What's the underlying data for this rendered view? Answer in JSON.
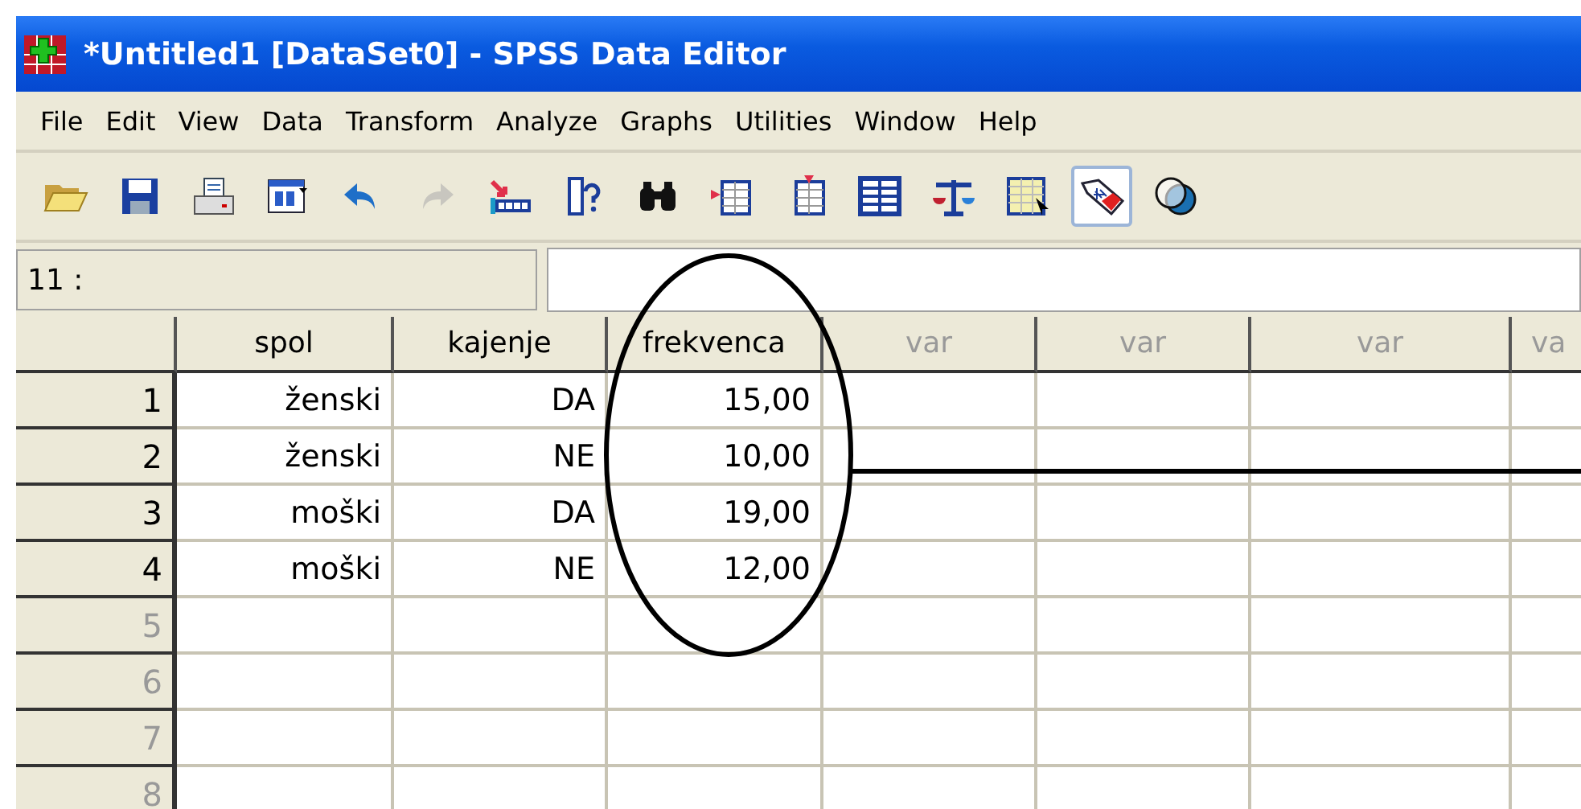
{
  "window": {
    "title": "*Untitled1 [DataSet0] - SPSS Data Editor"
  },
  "menu": [
    "File",
    "Edit",
    "View",
    "Data",
    "Transform",
    "Analyze",
    "Graphs",
    "Utilities",
    "Window",
    "Help"
  ],
  "toolbar": [
    {
      "kind": "open",
      "pressed": false,
      "disabled": false
    },
    {
      "kind": "save",
      "pressed": false,
      "disabled": false
    },
    {
      "kind": "print",
      "pressed": false,
      "disabled": false
    },
    {
      "kind": "dialog",
      "pressed": false,
      "disabled": false
    },
    {
      "kind": "undo",
      "pressed": false,
      "disabled": false
    },
    {
      "kind": "redo",
      "pressed": false,
      "disabled": true
    },
    {
      "kind": "goto",
      "pressed": false,
      "disabled": false
    },
    {
      "kind": "variables",
      "pressed": false,
      "disabled": false
    },
    {
      "kind": "find",
      "pressed": false,
      "disabled": false
    },
    {
      "kind": "insert-case",
      "pressed": false,
      "disabled": false
    },
    {
      "kind": "insert-variable",
      "pressed": false,
      "disabled": false
    },
    {
      "kind": "split",
      "pressed": false,
      "disabled": false
    },
    {
      "kind": "weight",
      "pressed": false,
      "disabled": false
    },
    {
      "kind": "select",
      "pressed": false,
      "disabled": false
    },
    {
      "kind": "labels",
      "pressed": true,
      "disabled": false
    },
    {
      "kind": "sets",
      "pressed": false,
      "disabled": false
    }
  ],
  "cell_ref": "11 :",
  "table": {
    "columns": [
      {
        "label": "spol",
        "placeholder": false
      },
      {
        "label": "kajenje",
        "placeholder": false
      },
      {
        "label": "frekvenca",
        "placeholder": false
      },
      {
        "label": "var",
        "placeholder": true
      },
      {
        "label": "var",
        "placeholder": true
      },
      {
        "label": "var",
        "placeholder": true
      },
      {
        "label": "va",
        "placeholder": true
      }
    ],
    "rows": [
      {
        "number": "1",
        "empty": false,
        "cells": [
          "ženski",
          "DA",
          "15,00"
        ]
      },
      {
        "number": "2",
        "empty": false,
        "cells": [
          "ženski",
          "NE",
          "10,00"
        ]
      },
      {
        "number": "3",
        "empty": false,
        "cells": [
          "moški",
          "DA",
          "19,00"
        ]
      },
      {
        "number": "4",
        "empty": false,
        "cells": [
          "moški",
          "NE",
          "12,00"
        ]
      },
      {
        "number": "5",
        "empty": true,
        "cells": []
      },
      {
        "number": "6",
        "empty": true,
        "cells": []
      },
      {
        "number": "7",
        "empty": true,
        "cells": []
      },
      {
        "number": "8",
        "empty": true,
        "cells": []
      }
    ]
  }
}
